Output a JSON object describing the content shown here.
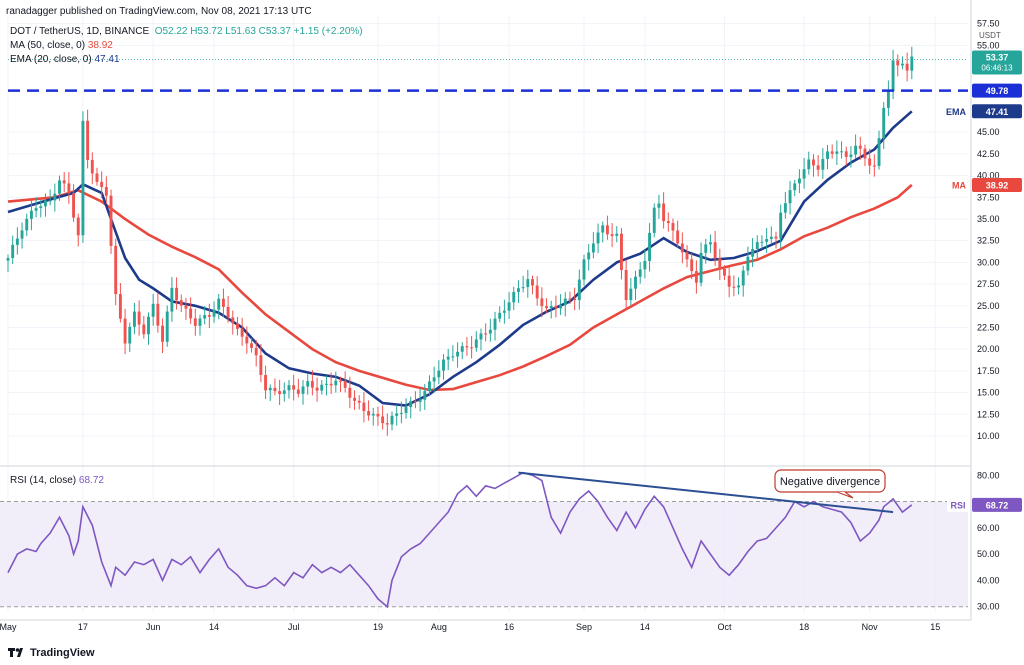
{
  "header": {
    "publisher": "ranadagger published on TradingView.com, Nov 08, 2021 17:13 UTC",
    "symbol_line": "DOT / TetherUS, 1D, BINANCE",
    "ohlc": "O52.22  H53.72  L51.63  C53.37  +1.15 (+2.20%)",
    "ma_label": "MA (50, close, 0)",
    "ma_value": "38.92",
    "ema_label": "EMA (20, close, 0)",
    "ema_value": "47.41",
    "rsi_label": "RSI (14, close)",
    "rsi_value": "68.72"
  },
  "footer": {
    "brand": "TradingView"
  },
  "price_axis": {
    "unit": "USDT",
    "ticks": [
      {
        "v": 57.5,
        "l": "57.50"
      },
      {
        "v": 55,
        "l": "55.00"
      },
      {
        "v": 45,
        "l": "45.00"
      },
      {
        "v": 42.5,
        "l": "42.50"
      },
      {
        "v": 40,
        "l": "40.00"
      },
      {
        "v": 37.5,
        "l": "37.50"
      },
      {
        "v": 35,
        "l": "35.00"
      },
      {
        "v": 32.5,
        "l": "32.50"
      },
      {
        "v": 30,
        "l": "30.00"
      },
      {
        "v": 27.5,
        "l": "27.50"
      },
      {
        "v": 25,
        "l": "25.00"
      },
      {
        "v": 22.5,
        "l": "22.50"
      },
      {
        "v": 20,
        "l": "20.00"
      },
      {
        "v": 17.5,
        "l": "17.50"
      },
      {
        "v": 15,
        "l": "15.00"
      },
      {
        "v": 12.5,
        "l": "12.50"
      },
      {
        "v": 10,
        "l": "10.00"
      }
    ],
    "range": [
      7,
      58.5
    ]
  },
  "rsi_axis": {
    "ticks": [
      {
        "v": 80,
        "l": "80.00"
      },
      {
        "v": 60,
        "l": "60.00"
      },
      {
        "v": 50,
        "l": "50.00"
      },
      {
        "v": 40,
        "l": "40.00"
      },
      {
        "v": 30,
        "l": "30.00"
      }
    ],
    "range": [
      28,
      82
    ],
    "band": [
      30,
      70
    ]
  },
  "x_axis": {
    "labels": [
      "May",
      "17",
      "Jun",
      "14",
      "Jul",
      "19",
      "Aug",
      "16",
      "Sep",
      "14",
      "Oct",
      "18",
      "Nov",
      "15"
    ]
  },
  "badges": {
    "price_value": "53.37",
    "countdown": "06:46:13",
    "resistance_value": "49.78",
    "ema_tag": "EMA",
    "ema_value": "47.41",
    "ma_tag": "MA",
    "ma_value": "38.92",
    "rsi_tag": "RSI",
    "rsi_value": "68.72"
  },
  "annotation": {
    "text": "Negative divergence"
  },
  "colors": {
    "up": "#26a69a",
    "down": "#ef5350",
    "ema": "#1e3a8a",
    "ma": "#e8483d",
    "resistance": "#1b2fd6",
    "rsi": "#7e57c2",
    "divergence": "#2c4f94",
    "annotation": "#c0392b"
  },
  "chart_data": {
    "type": "candlestick",
    "title": "DOT / TetherUS, 1D, BINANCE",
    "resistance_level": 49.78,
    "x_ticks": [
      {
        "label": "May",
        "day": 0
      },
      {
        "label": "17",
        "day": 16
      },
      {
        "label": "Jun",
        "day": 31
      },
      {
        "label": "14",
        "day": 44
      },
      {
        "label": "Jul",
        "day": 61
      },
      {
        "label": "19",
        "day": 79
      },
      {
        "label": "Aug",
        "day": 92
      },
      {
        "label": "16",
        "day": 107
      },
      {
        "label": "Sep",
        "day": 123
      },
      {
        "label": "14",
        "day": 136
      },
      {
        "label": "Oct",
        "day": 153
      },
      {
        "label": "18",
        "day": 170
      },
      {
        "label": "Nov",
        "day": 184
      },
      {
        "label": "15",
        "day": 198
      }
    ],
    "close_path": [
      [
        0,
        30.5
      ],
      [
        3,
        34
      ],
      [
        6,
        36.5
      ],
      [
        9,
        37
      ],
      [
        11,
        39.5
      ],
      [
        13,
        38
      ],
      [
        15,
        33
      ],
      [
        16,
        46
      ],
      [
        17,
        42
      ],
      [
        19,
        39
      ],
      [
        21,
        38
      ],
      [
        23,
        26
      ],
      [
        25,
        21
      ],
      [
        27,
        24
      ],
      [
        29,
        22
      ],
      [
        31,
        25
      ],
      [
        33,
        21
      ],
      [
        35,
        27
      ],
      [
        37,
        25
      ],
      [
        40,
        23
      ],
      [
        43,
        24
      ],
      [
        45,
        25.5
      ],
      [
        47,
        24
      ],
      [
        49,
        22
      ],
      [
        51,
        21
      ],
      [
        53,
        19
      ],
      [
        55,
        15.5
      ],
      [
        57,
        15
      ],
      [
        60,
        15.5
      ],
      [
        62,
        15.2
      ],
      [
        64,
        16
      ],
      [
        66,
        15.5
      ],
      [
        68,
        15.8
      ],
      [
        70,
        16.5
      ],
      [
        72,
        15.5
      ],
      [
        74,
        14
      ],
      [
        76,
        13
      ],
      [
        79,
        12
      ],
      [
        81,
        11.5
      ],
      [
        84,
        13
      ],
      [
        87,
        14
      ],
      [
        89,
        15
      ],
      [
        91,
        17
      ],
      [
        93,
        18.5
      ],
      [
        95,
        19.5
      ],
      [
        97,
        20
      ],
      [
        99,
        20.5
      ],
      [
        101,
        21.5
      ],
      [
        103,
        22.5
      ],
      [
        105,
        24
      ],
      [
        107,
        25.5
      ],
      [
        109,
        27
      ],
      [
        111,
        28
      ],
      [
        113,
        26
      ],
      [
        115,
        24.5
      ],
      [
        117,
        25
      ],
      [
        119,
        25.5
      ],
      [
        121,
        26
      ],
      [
        123,
        30
      ],
      [
        125,
        32.5
      ],
      [
        127,
        34
      ],
      [
        128,
        33.5
      ],
      [
        130,
        33
      ],
      [
        131,
        29
      ],
      [
        132,
        26
      ],
      [
        134,
        28
      ],
      [
        136,
        30.5
      ],
      [
        138,
        36
      ],
      [
        139,
        37
      ],
      [
        140,
        35
      ],
      [
        142,
        33.5
      ],
      [
        143,
        32.5
      ],
      [
        145,
        30
      ],
      [
        147,
        28
      ],
      [
        148,
        31
      ],
      [
        150,
        32.5
      ],
      [
        152,
        29
      ],
      [
        154,
        27.5
      ],
      [
        156,
        27
      ],
      [
        158,
        31
      ],
      [
        160,
        32
      ],
      [
        162,
        33
      ],
      [
        164,
        32.5
      ],
      [
        165,
        36
      ],
      [
        167,
        38
      ],
      [
        169,
        40
      ],
      [
        171,
        41.5
      ],
      [
        173,
        41
      ],
      [
        175,
        42.5
      ],
      [
        177,
        43
      ],
      [
        179,
        42
      ],
      [
        181,
        43.5
      ],
      [
        183,
        42
      ],
      [
        185,
        41
      ],
      [
        186,
        44
      ],
      [
        187,
        48
      ],
      [
        188,
        50
      ],
      [
        189,
        53
      ],
      [
        190,
        52.5
      ],
      [
        191,
        53.2
      ],
      [
        192,
        52.2
      ],
      [
        193,
        53.37
      ]
    ],
    "series": [
      {
        "name": "EMA (20, close, 0)",
        "points": [
          [
            0,
            35.8
          ],
          [
            10,
            37.4
          ],
          [
            14,
            38
          ],
          [
            16,
            39
          ],
          [
            20,
            38
          ],
          [
            22,
            35
          ],
          [
            25,
            30.5
          ],
          [
            28,
            28
          ],
          [
            31,
            27
          ],
          [
            35,
            25.5
          ],
          [
            40,
            25
          ],
          [
            45,
            24.2
          ],
          [
            50,
            22.5
          ],
          [
            55,
            19.5
          ],
          [
            60,
            17.8
          ],
          [
            65,
            17.2
          ],
          [
            70,
            16.8
          ],
          [
            75,
            15.8
          ],
          [
            80,
            13.8
          ],
          [
            85,
            13.5
          ],
          [
            90,
            14.8
          ],
          [
            95,
            16.8
          ],
          [
            100,
            18.5
          ],
          [
            105,
            20.5
          ],
          [
            110,
            22.8
          ],
          [
            115,
            24.3
          ],
          [
            120,
            25.5
          ],
          [
            125,
            28
          ],
          [
            130,
            30
          ],
          [
            135,
            31
          ],
          [
            140,
            32.8
          ],
          [
            145,
            31.2
          ],
          [
            150,
            30.3
          ],
          [
            155,
            30.5
          ],
          [
            160,
            31.3
          ],
          [
            165,
            32.5
          ],
          [
            170,
            37
          ],
          [
            175,
            39.5
          ],
          [
            180,
            41.5
          ],
          [
            185,
            43
          ],
          [
            189,
            45.5
          ],
          [
            193,
            47.41
          ]
        ]
      },
      {
        "name": "MA (50, close, 0)",
        "points": [
          [
            0,
            37
          ],
          [
            10,
            37.5
          ],
          [
            15,
            38.3
          ],
          [
            20,
            37
          ],
          [
            25,
            35
          ],
          [
            30,
            33.2
          ],
          [
            35,
            31.8
          ],
          [
            40,
            30.6
          ],
          [
            45,
            29.2
          ],
          [
            50,
            26.5
          ],
          [
            55,
            24
          ],
          [
            60,
            22
          ],
          [
            65,
            20
          ],
          [
            70,
            18.5
          ],
          [
            75,
            17.5
          ],
          [
            80,
            16.7
          ],
          [
            85,
            15.9
          ],
          [
            90,
            15.3
          ],
          [
            95,
            15.4
          ],
          [
            100,
            16.2
          ],
          [
            105,
            17
          ],
          [
            110,
            18
          ],
          [
            115,
            19.2
          ],
          [
            120,
            20.5
          ],
          [
            125,
            22.5
          ],
          [
            130,
            24
          ],
          [
            135,
            25.5
          ],
          [
            140,
            27
          ],
          [
            145,
            28.3
          ],
          [
            150,
            29
          ],
          [
            155,
            29.7
          ],
          [
            160,
            30.3
          ],
          [
            165,
            31.5
          ],
          [
            170,
            33
          ],
          [
            175,
            34
          ],
          [
            180,
            35.2
          ],
          [
            185,
            36.2
          ],
          [
            190,
            37.5
          ],
          [
            193,
            38.92
          ]
        ]
      }
    ],
    "rsi": {
      "name": "RSI (14, close)",
      "last": 68.72,
      "points": [
        [
          0,
          43
        ],
        [
          2,
          50
        ],
        [
          4,
          52
        ],
        [
          6,
          51
        ],
        [
          7,
          54
        ],
        [
          9,
          58
        ],
        [
          11,
          64
        ],
        [
          13,
          57
        ],
        [
          14,
          50
        ],
        [
          15,
          55
        ],
        [
          16,
          68
        ],
        [
          18,
          61
        ],
        [
          20,
          47
        ],
        [
          22,
          38
        ],
        [
          23,
          45
        ],
        [
          25,
          42
        ],
        [
          27,
          47
        ],
        [
          29,
          46
        ],
        [
          31,
          48
        ],
        [
          33,
          40
        ],
        [
          35,
          48
        ],
        [
          37,
          46
        ],
        [
          39,
          49
        ],
        [
          41,
          43
        ],
        [
          43,
          48
        ],
        [
          45,
          52
        ],
        [
          47,
          45
        ],
        [
          49,
          42
        ],
        [
          51,
          38
        ],
        [
          53,
          37
        ],
        [
          55,
          38
        ],
        [
          57,
          41
        ],
        [
          59,
          38
        ],
        [
          61,
          43
        ],
        [
          63,
          41
        ],
        [
          65,
          46
        ],
        [
          67,
          43
        ],
        [
          69,
          45
        ],
        [
          71,
          43
        ],
        [
          73,
          46
        ],
        [
          75,
          42
        ],
        [
          77,
          38
        ],
        [
          79,
          33
        ],
        [
          81,
          30
        ],
        [
          82,
          40
        ],
        [
          84,
          49
        ],
        [
          86,
          52
        ],
        [
          88,
          54
        ],
        [
          90,
          58
        ],
        [
          92,
          62
        ],
        [
          94,
          66
        ],
        [
          96,
          73
        ],
        [
          98,
          76
        ],
        [
          100,
          72
        ],
        [
          102,
          76
        ],
        [
          104,
          75
        ],
        [
          106,
          77
        ],
        [
          108,
          79
        ],
        [
          110,
          81
        ],
        [
          112,
          80
        ],
        [
          114,
          78
        ],
        [
          116,
          64
        ],
        [
          118,
          58
        ],
        [
          120,
          66
        ],
        [
          122,
          71
        ],
        [
          124,
          74
        ],
        [
          126,
          70
        ],
        [
          128,
          64
        ],
        [
          130,
          59
        ],
        [
          132,
          66
        ],
        [
          134,
          60
        ],
        [
          136,
          67
        ],
        [
          138,
          72
        ],
        [
          140,
          68
        ],
        [
          142,
          60
        ],
        [
          144,
          52
        ],
        [
          146,
          45
        ],
        [
          148,
          55
        ],
        [
          150,
          50
        ],
        [
          152,
          45
        ],
        [
          154,
          42
        ],
        [
          156,
          46
        ],
        [
          158,
          51
        ],
        [
          160,
          55
        ],
        [
          162,
          56
        ],
        [
          164,
          60
        ],
        [
          166,
          64
        ],
        [
          168,
          70
        ],
        [
          170,
          68
        ],
        [
          172,
          70
        ],
        [
          174,
          68
        ],
        [
          176,
          67
        ],
        [
          178,
          66
        ],
        [
          180,
          62
        ],
        [
          182,
          55
        ],
        [
          184,
          58
        ],
        [
          186,
          63
        ],
        [
          187,
          68
        ],
        [
          189,
          71
        ],
        [
          191,
          66
        ],
        [
          193,
          68.72
        ]
      ]
    },
    "divergence_line": [
      [
        109,
        81
      ],
      [
        189,
        66
      ]
    ]
  }
}
